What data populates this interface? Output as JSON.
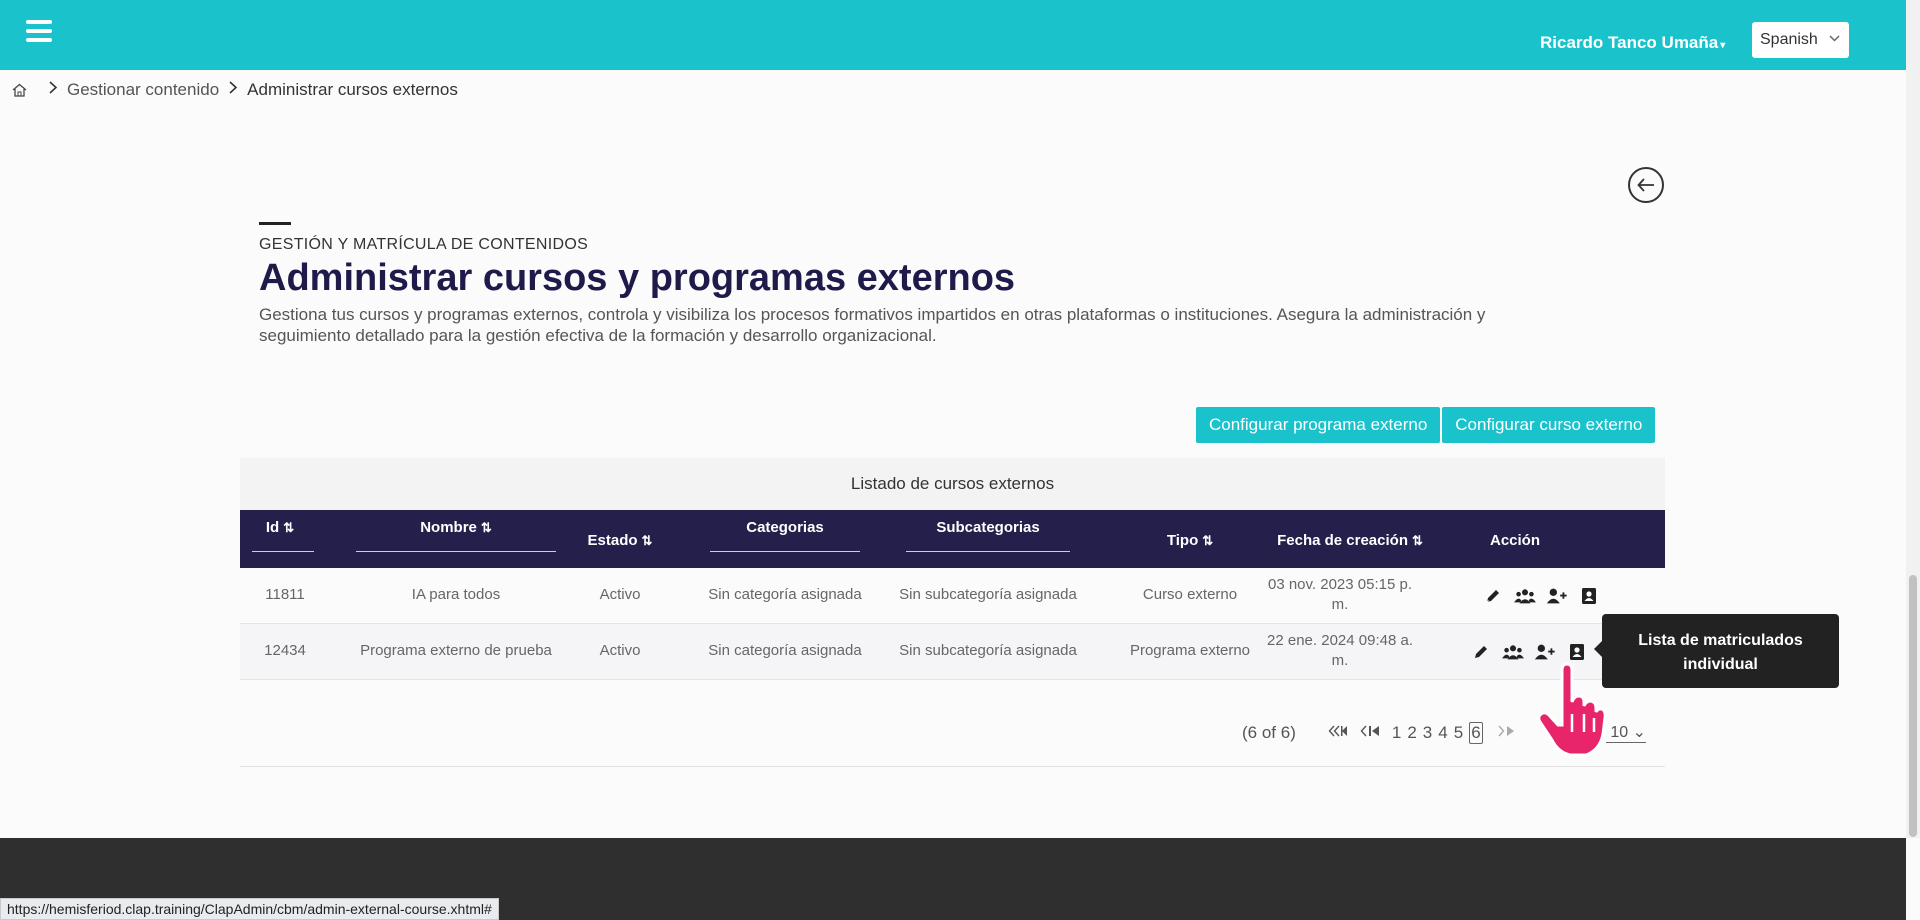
{
  "header": {
    "user_name": "Ricardo Tanco Umaña",
    "language": "Spanish"
  },
  "breadcrumb": {
    "items": [
      "Gestionar contenido",
      "Administrar cursos externos"
    ]
  },
  "page": {
    "eyebrow": "GESTIÓN Y MATRÍCULA DE CONTENIDOS",
    "title": "Administrar cursos y programas externos",
    "description": "Gestiona tus cursos y programas externos, controla y visibiliza los procesos formativos impartidos en otras plataformas o instituciones. Asegura la administración y seguimiento detallado para la gestión efectiva de la formación y desarrollo organizacional."
  },
  "buttons": {
    "config_program": "Configurar programa externo",
    "config_course": "Configurar curso externo"
  },
  "table": {
    "caption": "Listado de cursos externos",
    "columns": [
      "Id",
      "Nombre",
      "Estado",
      "Categorias",
      "Subcategorias",
      "Tipo",
      "Fecha de creación",
      "Acción"
    ],
    "rows": [
      {
        "id": "11811",
        "nombre": "IA para todos",
        "estado": "Activo",
        "categoria": "Sin categoría asignada",
        "subcategoria": "Sin subcategoría asignada",
        "tipo": "Curso externo",
        "fecha": "03 nov. 2023 05:15 p. m."
      },
      {
        "id": "12434",
        "nombre": "Programa externo de prueba",
        "estado": "Activo",
        "categoria": "Sin categoría asignada",
        "subcategoria": "Sin subcategoría asignada",
        "tipo": "Programa externo",
        "fecha": "22 ene. 2024 09:48 a. m."
      }
    ]
  },
  "pagination": {
    "summary": "(6 of 6)",
    "pages": [
      "1",
      "2",
      "3",
      "4",
      "5",
      "6"
    ],
    "current_page": "6",
    "rows_per_page": "10"
  },
  "tooltip": {
    "text": "Lista de matriculados individual"
  },
  "status_bar": {
    "url": "https://hemisferiod.clap.training/ClapAdmin/cbm/admin-external-course.xhtml#"
  },
  "colors": {
    "accent": "#1ac2cc",
    "table_header": "#251f4b",
    "title": "#1e1a4a",
    "cursor": "#e8246b"
  }
}
